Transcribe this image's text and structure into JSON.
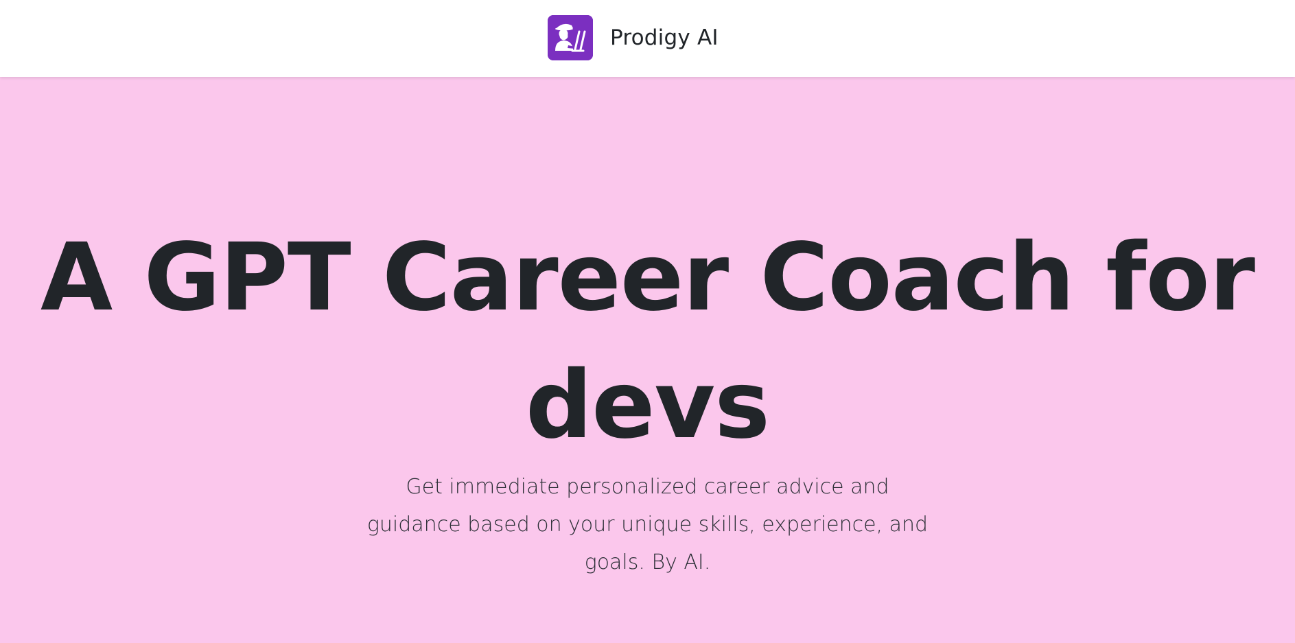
{
  "navbar": {
    "brand_name": "Prodigy AI",
    "logo_icon": "developer-at-laptop-icon",
    "logo_bg_color": "#7b2fc0"
  },
  "hero": {
    "headline": "A GPT Career Coach for devs",
    "lead": "Get immediate personalized career advice and guidance based on your unique skills, experience, and goals. By AI.",
    "background_color": "#fbc7ec",
    "text_color": "#212529"
  }
}
